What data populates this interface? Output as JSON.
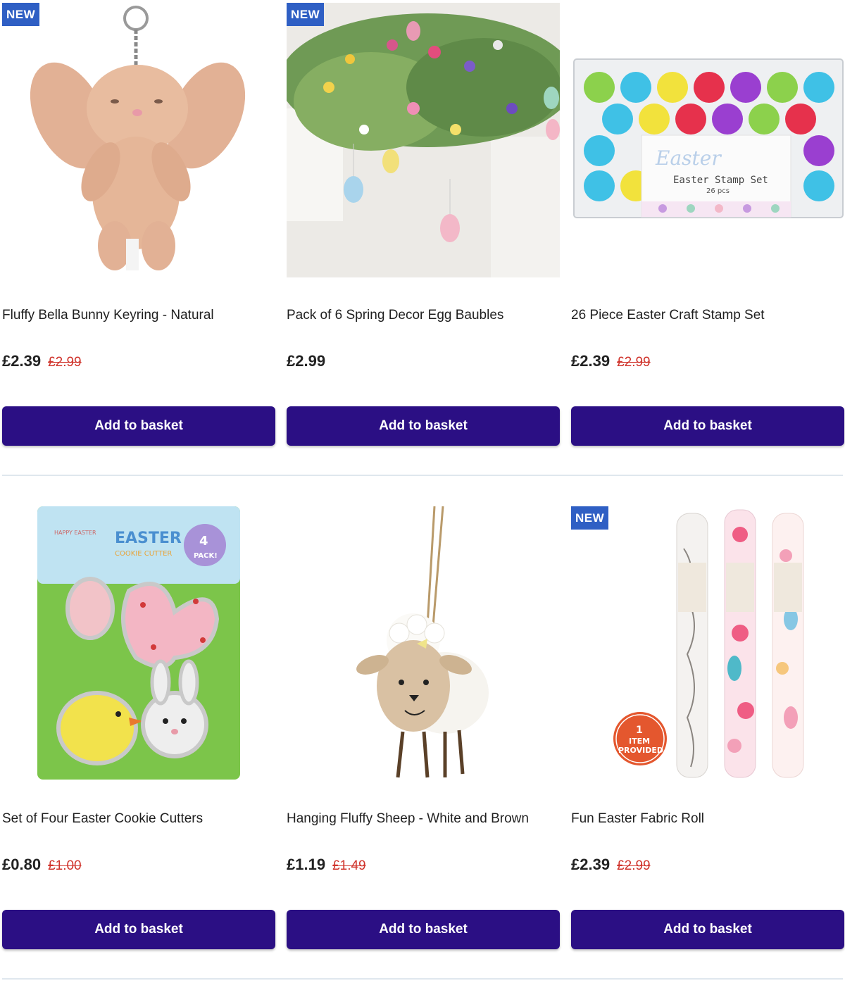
{
  "products": [
    {
      "title": "Fluffy Bella Bunny Keyring - Natural",
      "price": "£2.39",
      "was": "£2.99",
      "badge": "NEW",
      "button": "Add to basket"
    },
    {
      "title": "Pack of 6 Spring Decor Egg Baubles",
      "price": "£2.99",
      "was": "",
      "badge": "NEW",
      "button": "Add to basket"
    },
    {
      "title": "26 Piece Easter Craft Stamp Set",
      "price": "£2.39",
      "was": "£2.99",
      "badge": "",
      "button": "Add to basket"
    },
    {
      "title": "Set of Four Easter Cookie Cutters",
      "price": "£0.80",
      "was": "£1.00",
      "badge": "",
      "button": "Add to basket"
    },
    {
      "title": "Hanging Fluffy Sheep - White and Brown",
      "price": "£1.19",
      "was": "£1.49",
      "badge": "",
      "button": "Add to basket"
    },
    {
      "title": "Fun Easter Fabric Roll",
      "price": "£2.39",
      "was": "£2.99",
      "badge": "NEW",
      "button": "Add to basket"
    }
  ],
  "images": {
    "stamp_box_label": "Easter Stamp Set",
    "stamp_box_sub": "26 pcs",
    "stamp_box_brand": "Easter",
    "cookie_pack_title": "EASTER",
    "cookie_pack_sub": "COOKIE CUTTER",
    "cookie_pack_badge_num": "4",
    "cookie_pack_badge_text": "PACK!",
    "cookie_pack_happy": "HAPPY EASTER",
    "fabric_sticker_num": "1",
    "fabric_sticker_l1": "ITEM",
    "fabric_sticker_l2": "PROVIDED"
  },
  "colors": {
    "button": "#2b0f84",
    "badge": "#2f5fc4",
    "was_price": "#d0342c",
    "divider": "#dfe7ee"
  }
}
